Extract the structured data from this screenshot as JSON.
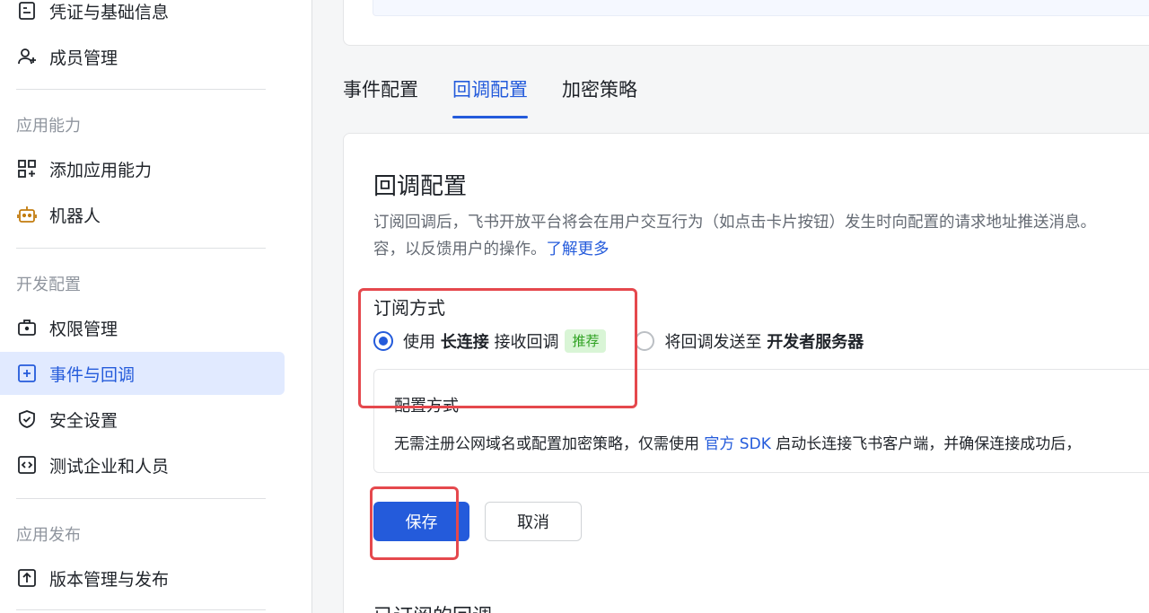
{
  "sidebar": {
    "items_top": [
      {
        "label": "凭证与基础信息",
        "icon": "document-icon"
      },
      {
        "label": "成员管理",
        "icon": "user-add-icon"
      }
    ],
    "sections": [
      {
        "title": "应用能力",
        "items": [
          {
            "label": "添加应用能力",
            "icon": "grid-add-icon"
          },
          {
            "label": "机器人",
            "icon": "robot-icon"
          }
        ]
      },
      {
        "title": "开发配置",
        "items": [
          {
            "label": "权限管理",
            "icon": "briefcase-icon"
          },
          {
            "label": "事件与回调",
            "icon": "event-plus-icon",
            "active": true
          },
          {
            "label": "安全设置",
            "icon": "shield-icon"
          },
          {
            "label": "测试企业和人员",
            "icon": "code-icon"
          }
        ]
      },
      {
        "title": "应用发布",
        "items": [
          {
            "label": "版本管理与发布",
            "icon": "upload-icon"
          }
        ]
      }
    ]
  },
  "tabs": [
    {
      "label": "事件配置"
    },
    {
      "label": "回调配置",
      "active": true
    },
    {
      "label": "加密策略"
    }
  ],
  "callback": {
    "title": "回调配置",
    "desc_line1": "订阅回调后，飞书开放平台将会在用户交互行为（如点击卡片按钮）发生时向配置的请求地址推送消息。",
    "desc_line2": "容，以反馈用户的操作。",
    "learn_more": "了解更多",
    "sub_title": "订阅方式",
    "option1": {
      "prefix": "使用",
      "bold": "长连接",
      "suffix": "接收回调",
      "badge": "推荐"
    },
    "option2": {
      "prefix": "将回调发送至",
      "bold": "开发者服务器"
    },
    "info": {
      "title": "配置方式",
      "text_before": "无需注册公网域名或配置加密策略，仅需使用",
      "link": "官方 SDK",
      "text_after": "启动长连接飞书客户端，并确保连接成功后，"
    },
    "save_label": "保存",
    "cancel_label": "取消",
    "next_section_title": "已订阅的回调"
  },
  "colors": {
    "accent": "#245bdb",
    "highlight": "#e5484d",
    "badge_green": "#2ea121"
  }
}
